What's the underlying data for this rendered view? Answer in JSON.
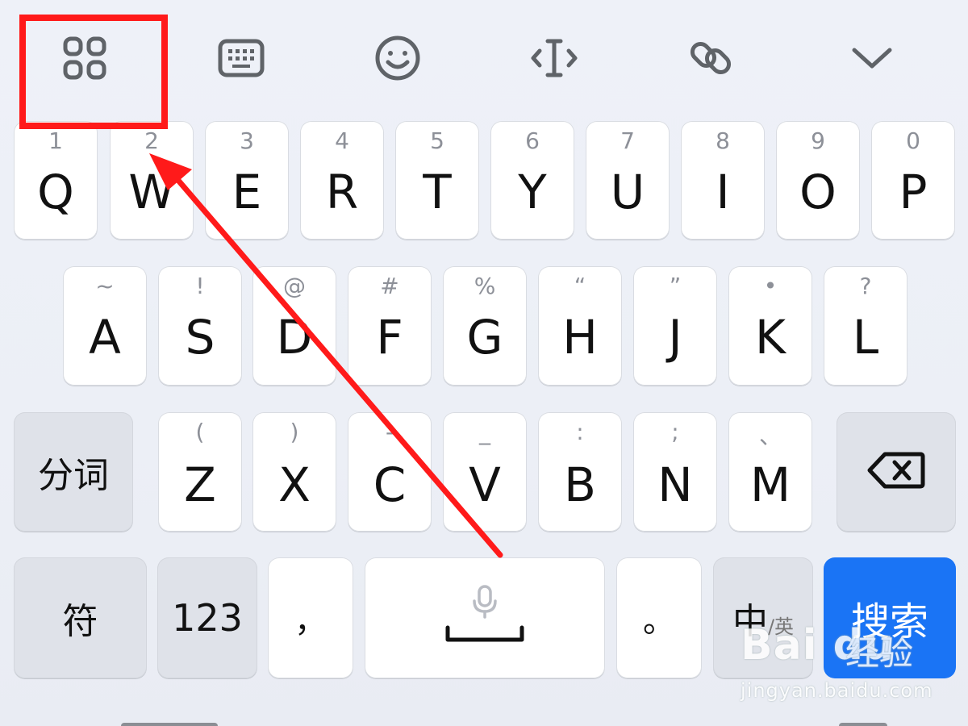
{
  "toolbar": {
    "items": [
      {
        "name": "apps-grid-icon"
      },
      {
        "name": "keyboard-icon"
      },
      {
        "name": "emoji-icon"
      },
      {
        "name": "text-cursor-icon"
      },
      {
        "name": "clipboard-link-icon"
      },
      {
        "name": "collapse-chevron-icon"
      }
    ],
    "icon_color": "#5f6368"
  },
  "row1": [
    {
      "hint": "1",
      "label": "Q"
    },
    {
      "hint": "2",
      "label": "W"
    },
    {
      "hint": "3",
      "label": "E"
    },
    {
      "hint": "4",
      "label": "R"
    },
    {
      "hint": "5",
      "label": "T"
    },
    {
      "hint": "6",
      "label": "Y"
    },
    {
      "hint": "7",
      "label": "U"
    },
    {
      "hint": "8",
      "label": "I"
    },
    {
      "hint": "9",
      "label": "O"
    },
    {
      "hint": "0",
      "label": "P"
    }
  ],
  "row2": [
    {
      "hint": "~",
      "label": "A"
    },
    {
      "hint": "!",
      "label": "S"
    },
    {
      "hint": "@",
      "label": "D"
    },
    {
      "hint": "#",
      "label": "F"
    },
    {
      "hint": "%",
      "label": "G"
    },
    {
      "hint": "“",
      "label": "H"
    },
    {
      "hint": "”",
      "label": "J"
    },
    {
      "hint": "•",
      "label": "K"
    },
    {
      "hint": "?",
      "label": "L"
    }
  ],
  "row3": {
    "segment_label": "分词",
    "keys": [
      {
        "hint": "(",
        "label": "Z"
      },
      {
        "hint": ")",
        "label": "X"
      },
      {
        "hint": "-",
        "label": "C"
      },
      {
        "hint": "_",
        "label": "V"
      },
      {
        "hint": ":",
        "label": "B"
      },
      {
        "hint": ";",
        "label": "N"
      },
      {
        "hint": "、",
        "label": "M"
      }
    ]
  },
  "row4": {
    "symbols_label": "符",
    "numbers_label": "123",
    "comma_label": "，",
    "period_label": "。",
    "lang_main": "中",
    "lang_alt": "/英",
    "search_label": "搜索"
  },
  "watermark": {
    "logo": "Bai du",
    "cn": "经验",
    "url": "jingyan.baidu.com"
  },
  "colors": {
    "accent": "#1a74f5",
    "highlight": "#ff1a1a"
  }
}
